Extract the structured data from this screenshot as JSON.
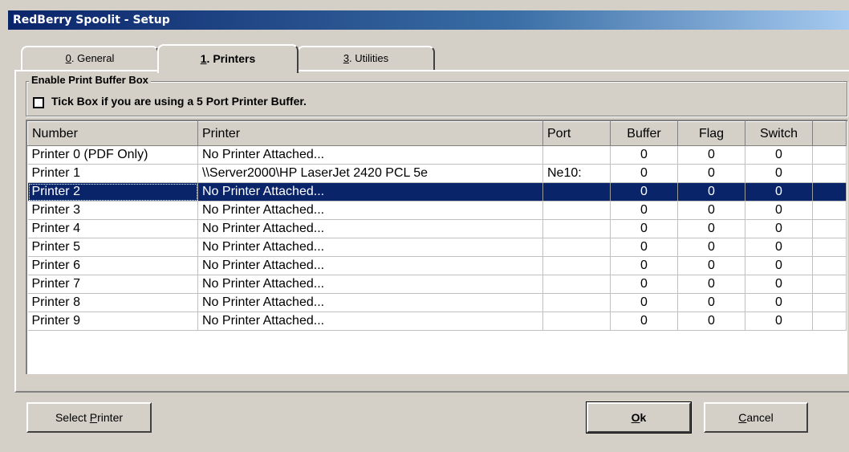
{
  "window": {
    "title": "RedBerry Spoolit - Setup"
  },
  "tabs": [
    {
      "accel": "0",
      "rest": ". General"
    },
    {
      "accel": "1",
      "rest": ". Printers"
    },
    {
      "accel": "3",
      "rest": ". Utilities"
    }
  ],
  "groupbox": {
    "legend": "Enable Print Buffer Box",
    "checkbox_label": "Tick Box if you are using a 5 Port Printer Buffer.",
    "checked": false
  },
  "table": {
    "columns": [
      "Number",
      "Printer",
      "Port",
      "Buffer",
      "Flag",
      "Switch"
    ],
    "selected_index": 2,
    "rows": [
      {
        "number": "Printer 0 (PDF Only)",
        "printer": "No Printer Attached...",
        "port": "",
        "buffer": "0",
        "flag": "0",
        "switch": "0"
      },
      {
        "number": "Printer 1",
        "printer": "\\\\Server2000\\HP LaserJet 2420 PCL 5e",
        "port": "Ne10:",
        "buffer": "0",
        "flag": "0",
        "switch": "0"
      },
      {
        "number": "Printer 2",
        "printer": "No Printer Attached...",
        "port": "",
        "buffer": "0",
        "flag": "0",
        "switch": "0"
      },
      {
        "number": "Printer 3",
        "printer": "No Printer Attached...",
        "port": "",
        "buffer": "0",
        "flag": "0",
        "switch": "0"
      },
      {
        "number": "Printer 4",
        "printer": "No Printer Attached...",
        "port": "",
        "buffer": "0",
        "flag": "0",
        "switch": "0"
      },
      {
        "number": "Printer 5",
        "printer": "No Printer Attached...",
        "port": "",
        "buffer": "0",
        "flag": "0",
        "switch": "0"
      },
      {
        "number": "Printer 6",
        "printer": "No Printer Attached...",
        "port": "",
        "buffer": "0",
        "flag": "0",
        "switch": "0"
      },
      {
        "number": "Printer 7",
        "printer": "No Printer Attached...",
        "port": "",
        "buffer": "0",
        "flag": "0",
        "switch": "0"
      },
      {
        "number": "Printer 8",
        "printer": "No Printer Attached...",
        "port": "",
        "buffer": "0",
        "flag": "0",
        "switch": "0"
      },
      {
        "number": "Printer 9",
        "printer": "No Printer Attached...",
        "port": "",
        "buffer": "0",
        "flag": "0",
        "switch": "0"
      }
    ]
  },
  "buttons": {
    "select_printer": {
      "pre": "Select ",
      "accel": "P",
      "post": "rinter"
    },
    "ok": {
      "pre": "",
      "accel": "O",
      "post": "k"
    },
    "cancel": {
      "pre": "",
      "accel": "C",
      "post": "ancel"
    }
  },
  "colors": {
    "title_start": "#0a246a",
    "selection": "#0a246a",
    "face": "#d4d0c8"
  }
}
